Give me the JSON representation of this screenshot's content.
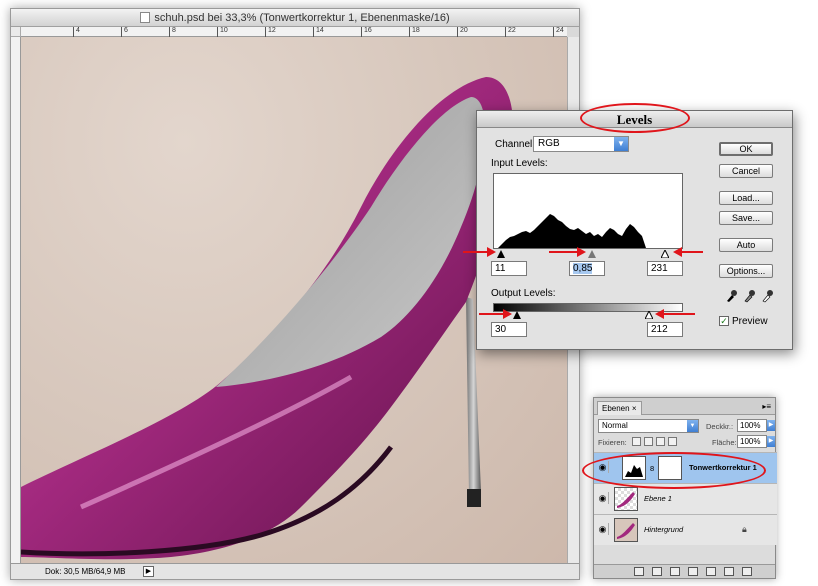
{
  "document": {
    "title": "schuh.psd bei 33,3% (Tonwertkorrektur 1, Ebenenmaske/16)",
    "ruler_marks": [
      "4",
      "6",
      "8",
      "10",
      "12",
      "14",
      "16",
      "18",
      "20",
      "22",
      "24"
    ],
    "status_text": "Dok: 30,5 MB/64,9 MB",
    "status_arrow": "▶"
  },
  "levels": {
    "title": "Levels",
    "channel_label": "Channel:",
    "channel_value": "RGB",
    "input_label": "Input Levels:",
    "input_black": "11",
    "input_gamma": "0,85",
    "input_white": "231",
    "output_label": "Output Levels:",
    "output_black": "30",
    "output_white": "212",
    "buttons": {
      "ok": "OK",
      "cancel": "Cancel",
      "load": "Load...",
      "save": "Save...",
      "auto": "Auto",
      "options": "Options..."
    },
    "preview_label": "Preview",
    "preview_checked": true
  },
  "layers": {
    "tab_label": "Ebenen",
    "tab_close": "×",
    "blend_mode": "Normal",
    "opacity_label": "Deckkr.:",
    "opacity_value": "100%",
    "lock_label": "Fixieren:",
    "fill_label": "Fläche:",
    "fill_value": "100%",
    "items": [
      {
        "name": "Tonwertkorrektur 1",
        "active": true
      },
      {
        "name": "Ebene 1",
        "active": false
      },
      {
        "name": "Hintergrund",
        "active": false
      }
    ]
  },
  "colors": {
    "annotation": "#e0151b",
    "shoe": "#a2297e",
    "selection": "#9fc5ee"
  }
}
